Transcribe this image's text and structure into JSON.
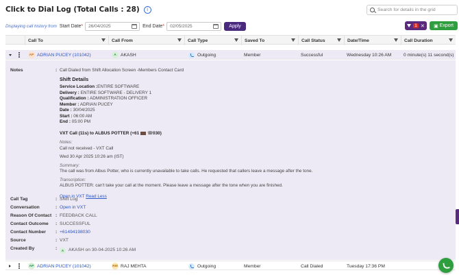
{
  "header": {
    "title": "Click to Dial Log (Total Calls : 28)",
    "search_placeholder": "Search for details in the grid"
  },
  "filterbar": {
    "hint": "Displaying call history from",
    "start_label": "Start Date",
    "start_value": "26/04/2025",
    "end_label": "End Date",
    "end_value": "02/05/2025",
    "required_mark": "*",
    "apply_label": "Apply",
    "filter_count": "1",
    "clear_mark": "✕",
    "export_label": "Export"
  },
  "columns": [
    "Call To",
    "Call From",
    "Call Type",
    "Saved To",
    "Call Status",
    "Date/Time",
    "Call Duration"
  ],
  "rows": [
    {
      "call_to_initials": "AP",
      "call_to": "ADRIAN PUCEY (101042)",
      "call_from_initials": "A",
      "call_from": "AKASH",
      "call_type": "Outgoing",
      "saved_to": "Member",
      "call_status": "Successful",
      "date_time": "Wednesday 10:26 AM",
      "duration": "0 minute(s) 11 second(s)"
    },
    {
      "call_to_initials": "AP",
      "call_to": "ADRIAN PUCEY (101042)",
      "call_from_initials": "RM",
      "call_from": "RAJ MEHTA",
      "call_type": "Outgoing",
      "saved_to": "Member",
      "call_status": "Call Dialed",
      "date_time": "Tuesday 17:36 PM",
      "duration": ""
    }
  ],
  "details": {
    "notes_label": "Notes",
    "colon": ":",
    "notes_intro": "Call Dialed from Shift Allocation Screen -Members Contact Card",
    "shift_title": "Shift Details",
    "service_location_key": "Service Location :",
    "service_location": "ENTIRE SOFTWARE",
    "delivery_key": "Delivery :",
    "delivery": "ENTIRE SOFTWARE - DELIVERY 1",
    "qualification_key": "Qualification :",
    "qualification": "ADMINISTRATION OFFICER",
    "member_key": "Member :",
    "member": "ADRIAN PUCEY",
    "date_key": "Date :",
    "date": "30/04/2025",
    "start_key": "Start :",
    "start": "06:00 AM",
    "end_key": "End :",
    "end": "05:00 PM",
    "vxt_call_prefix": "VXT Call (11s) to ALBUS POTTER (+61",
    "vxt_call_suffix": "030)",
    "vxt_notes_label": "Notes:",
    "vxt_notes": "Call not received - VXT Call",
    "vxt_datetime": "Wed 30 Apr 2025 10:26 am (IST)",
    "summary_label": "Summary:",
    "summary": "The call was from Albus Potter, who is currently unavailable to take calls. He requested that callers leave a message after the tone.",
    "transcription_label": "Transcription:",
    "transcription": "ALBUS POTTER: can't take your call at the moment. Please leave a message after the tone when you are finished.",
    "open_in_vxt": "Open in VXT",
    "read_less": "Read Less",
    "call_tag_label": "Call Tag",
    "call_tag": "Shift Log",
    "conversation_label": "Conversation",
    "conversation": "Open in VXT",
    "reason_label": "Reason Of Contact",
    "reason": "FEEDBACK CALL",
    "outcome_label": "Contact Outcome",
    "outcome": "SUCCESSFUL",
    "number_label": "Contact Number",
    "number": "+61494198030",
    "source_label": "Source",
    "source": "VXT",
    "created_label": "Created By",
    "created_initial": "A",
    "created_by": "AKASH on 30-04-2025 10:26 AM"
  },
  "colors": {
    "accent": "#4a2a7d",
    "export_green": "#2e9e3e",
    "link": "#2a56c6",
    "expanded_bg": "#eeeaf5"
  }
}
